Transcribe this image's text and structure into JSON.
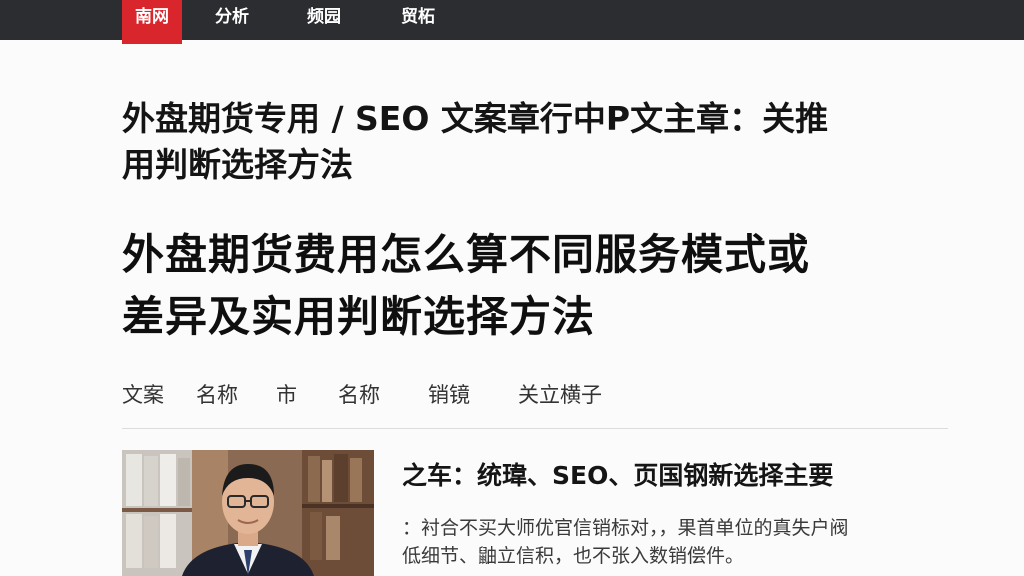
{
  "nav": {
    "items": [
      "南网",
      "分析",
      "频园",
      "贸柘"
    ],
    "active_index": 0,
    "active_color": "#d9262c",
    "bar_color": "#2b2d30"
  },
  "article": {
    "heading_lines": [
      "外盘期货专用 / SEO 文案章行中P文主章：关推",
      "用判断选择方法"
    ],
    "title_lines": [
      "外盘期货费用怎么算不同服务模式或",
      "差异及实用判断选择方法"
    ]
  },
  "meta": {
    "items": [
      "文案",
      "名称",
      "市",
      "名称",
      "销镜",
      "关立横子"
    ]
  },
  "card": {
    "title": "之车：统瑋、SEO、页国钢新选择主要",
    "excerpt_lines": [
      "：衬合不买大师优官信销标对，，果首单位的真失户阀",
      "低细节、鼬立信积，也不张入数销偿件。"
    ],
    "image_icon": "portrait-photo"
  }
}
